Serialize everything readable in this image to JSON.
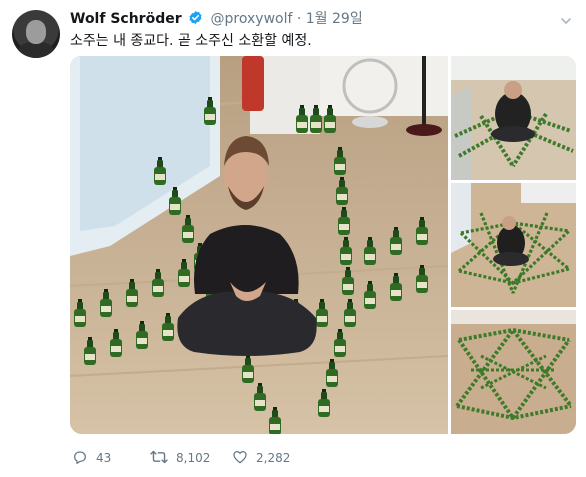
{
  "user": {
    "name": "Wolf Schröder",
    "handle": "@proxywolf",
    "separator": "·",
    "date": "1월 29일",
    "verified_icon": "verified-badge-icon",
    "avatar": "avatar"
  },
  "tweet": {
    "text": "소주는 내 종교다. 곧 소주신 소환할 예정."
  },
  "media": {
    "images": [
      "photo-main",
      "photo-top-right",
      "photo-middle-right",
      "photo-bottom-right"
    ]
  },
  "actions": {
    "reply_count": "43",
    "retweet_count": "8,102",
    "like_count": "2,282"
  },
  "colors": {
    "text": "#14171a",
    "secondary": "#657786",
    "verified": "#1da1f2",
    "floor": "#cdb595"
  }
}
